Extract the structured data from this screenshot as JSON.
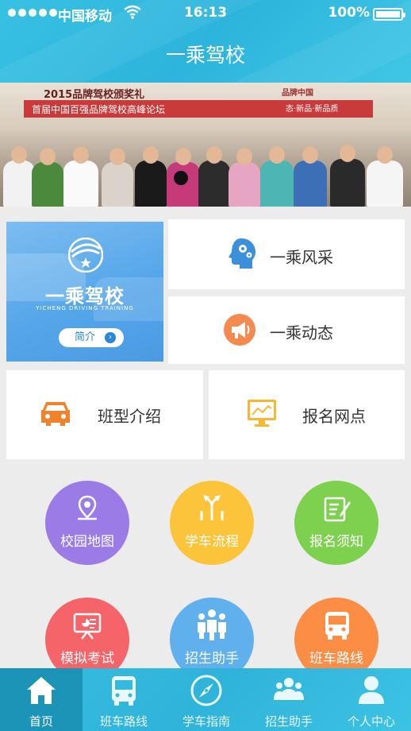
{
  "status_bar": {
    "carrier": "中国移动",
    "time": "16:13",
    "battery": "100%"
  },
  "header": {
    "title": "一乘驾校"
  },
  "banner": {
    "board_left": "2015品牌驾校颁奖礼",
    "board_right": "品牌中国",
    "board_sub": "首届中国百强品牌驾校高峰论坛",
    "board_sub2": "态·新品·新品质"
  },
  "promo": {
    "brand": "一乘驾校",
    "brand_en": "YICHENG DRIVING TRAINING",
    "button": "简介"
  },
  "tiles": {
    "style": "一乘风采",
    "news": "一乘动态",
    "class_types": "班型介绍",
    "sign_up_points": "报名网点"
  },
  "round_buttons": [
    {
      "label": "校园地图",
      "icon": "map-pin-icon",
      "color": "#9b7be6"
    },
    {
      "label": "学车流程",
      "icon": "route-arrows-icon",
      "color": "#fbc43a"
    },
    {
      "label": "报名须知",
      "icon": "notepad-icon",
      "color": "#7ed14f"
    },
    {
      "label": "模拟考试",
      "icon": "presentation-icon",
      "color": "#f56468"
    },
    {
      "label": "招生助手",
      "icon": "team-icon",
      "color": "#5fb0ec"
    },
    {
      "label": "班车路线",
      "icon": "bus-icon",
      "color": "#fb8d45"
    }
  ],
  "tabbar": [
    {
      "label": "首页",
      "icon": "home-icon"
    },
    {
      "label": "班车路线",
      "icon": "bus-icon"
    },
    {
      "label": "学车指南",
      "icon": "compass-icon"
    },
    {
      "label": "招生助手",
      "icon": "team-icon"
    },
    {
      "label": "个人中心",
      "icon": "person-icon"
    }
  ],
  "colors": {
    "header": "#2db4dc",
    "tab_active": "#1b94b8",
    "orange_icon": "#f0822c",
    "blue_icon": "#3c8fdb"
  }
}
